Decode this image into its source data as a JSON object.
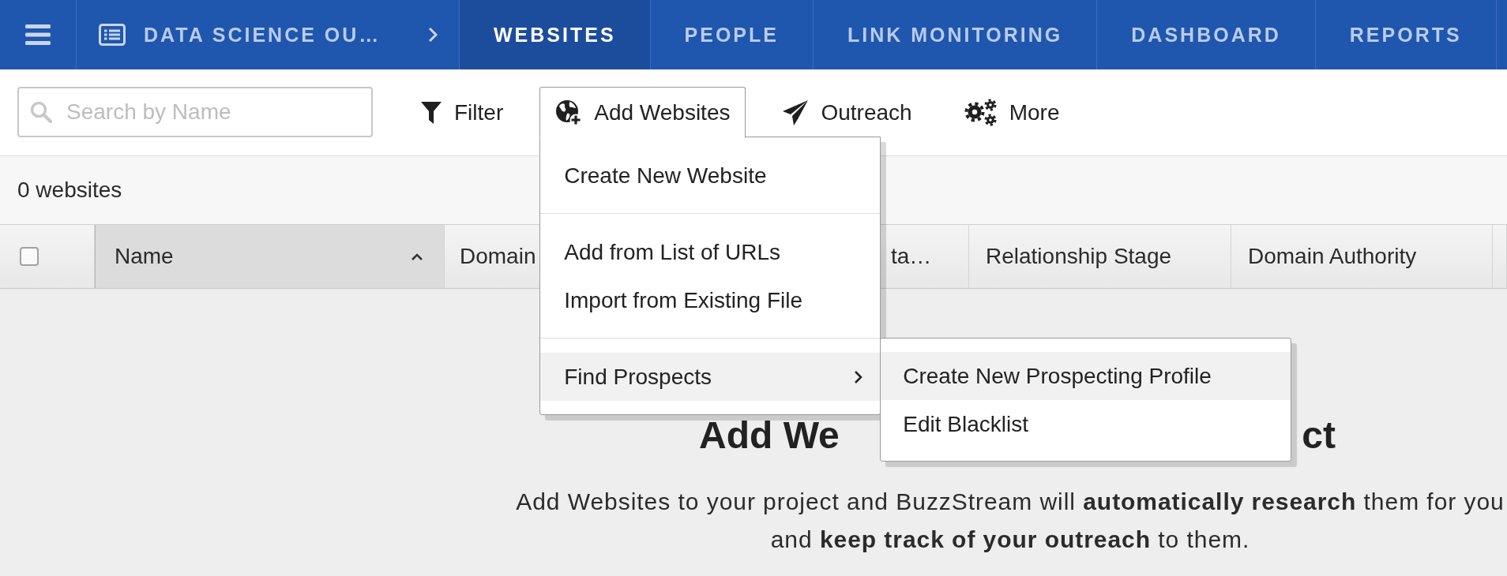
{
  "top_nav": {
    "project": {
      "name": "DATA SCIENCE OU…"
    },
    "tabs": [
      {
        "label": "WEBSITES",
        "selected": true
      },
      {
        "label": "PEOPLE",
        "selected": false
      },
      {
        "label": "LINK MONITORING",
        "selected": false
      },
      {
        "label": "DASHBOARD",
        "selected": false
      },
      {
        "label": "REPORTS",
        "selected": false
      }
    ]
  },
  "toolbar": {
    "search": {
      "placeholder": "Search by Name"
    },
    "buttons": [
      {
        "label": "Filter",
        "open": false
      },
      {
        "label": "Add Websites",
        "open": true,
        "menu": {
          "groups": [
            [
              {
                "label": "Create New Website",
                "highlighted": false
              }
            ],
            [
              {
                "label": "Add from List of URLs",
                "highlighted": false
              },
              {
                "label": "Import from Existing File",
                "highlighted": false
              }
            ],
            [
              {
                "label": "Find Prospects",
                "highlighted": true,
                "submenu": {
                  "items": [
                    {
                      "label": "Create New Prospecting Profile",
                      "highlighted": true
                    },
                    {
                      "label": "Edit Blacklist",
                      "highlighted": false
                    }
                  ]
                }
              }
            ]
          ]
        }
      },
      {
        "label": "Outreach",
        "open": false
      },
      {
        "label": "More",
        "open": false
      }
    ]
  },
  "count_bar": {
    "text": "0 websites"
  },
  "table": {
    "select_all": {
      "checked": false
    },
    "columns": [
      {
        "label": "Name",
        "sorted": true
      },
      {
        "label": "Domain",
        "sorted": false
      },
      {
        "label": "ta…",
        "sorted": false
      },
      {
        "label": "Relationship Stage",
        "sorted": false
      },
      {
        "label": "Domain Authority",
        "sorted": false
      }
    ]
  },
  "empty_state": {
    "heading_fragments": [
      "Add We",
      "ct"
    ],
    "description": "Add Websites to your project and BuzzStream will **automatically research** them for you and **keep track of your outreach** to them."
  }
}
